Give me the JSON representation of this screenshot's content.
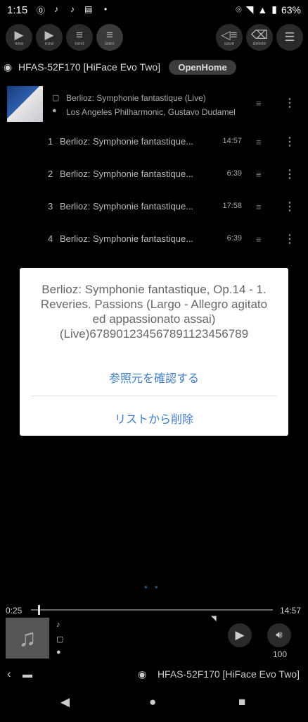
{
  "status": {
    "time": "1:15",
    "battery": "63%"
  },
  "toolbar": {
    "new_label": "new",
    "now_label": "now",
    "next_label": "next",
    "later_label": "later",
    "save_label": "save",
    "delete_label": "delete"
  },
  "device": {
    "name": "HFAS-52F170 [HiFace Evo Two]",
    "mode": "OpenHome"
  },
  "album": {
    "title": "Berlioz: Symphonie fantastique (Live)",
    "artist": "Los Angeles Philharmonic, Gustavo Dudamel"
  },
  "tracks": [
    {
      "num": "1",
      "title": "Berlioz: Symphonie fantastique...",
      "duration": "14:57"
    },
    {
      "num": "2",
      "title": "Berlioz: Symphonie fantastique...",
      "duration": "6:39"
    },
    {
      "num": "3",
      "title": "Berlioz: Symphonie fantastique...",
      "duration": "17:58"
    },
    {
      "num": "4",
      "title": "Berlioz: Symphonie fantastique...",
      "duration": "6:39"
    }
  ],
  "dialog": {
    "message": "Berlioz: Symphonie fantastique, Op.14 - 1. Reveries. Passions (Largo - Allegro agitato ed appassionato assai) (Live)6789012345678911234567​89",
    "option_check_source": "参照元を確認する",
    "option_remove": "リストから削除"
  },
  "player": {
    "elapsed": "0:25",
    "total": "14:57",
    "progress_fraction": 0.028,
    "volume": "100"
  },
  "bottom": {
    "device_name": "HFAS-52F170 [HiFace Evo Two]"
  }
}
